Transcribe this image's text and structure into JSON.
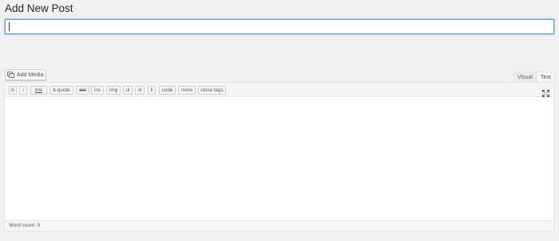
{
  "page": {
    "title": "Add New Post"
  },
  "title_field": {
    "value": "",
    "placeholder": ""
  },
  "media": {
    "add_media_label": "Add Media",
    "icon": "add-media-icon"
  },
  "editor_tabs": {
    "visual": "Visual",
    "text": "Text"
  },
  "quicktags": [
    {
      "id": "b",
      "label": "b"
    },
    {
      "id": "i",
      "label": "i"
    },
    {
      "id": "link",
      "label": "link"
    },
    {
      "id": "bquote",
      "label": "b-quote"
    },
    {
      "id": "del",
      "label": "del"
    },
    {
      "id": "ins",
      "label": "ins"
    },
    {
      "id": "img",
      "label": "img"
    },
    {
      "id": "ul",
      "label": "ul"
    },
    {
      "id": "ol",
      "label": "ol"
    },
    {
      "id": "li",
      "label": "li"
    },
    {
      "id": "code",
      "label": "code"
    },
    {
      "id": "more",
      "label": "more"
    },
    {
      "id": "close",
      "label": "close tags"
    }
  ],
  "fullscreen": {
    "icon": "fullscreen-icon"
  },
  "content": {
    "value": ""
  },
  "status": {
    "word_count": "Word count: 0"
  }
}
